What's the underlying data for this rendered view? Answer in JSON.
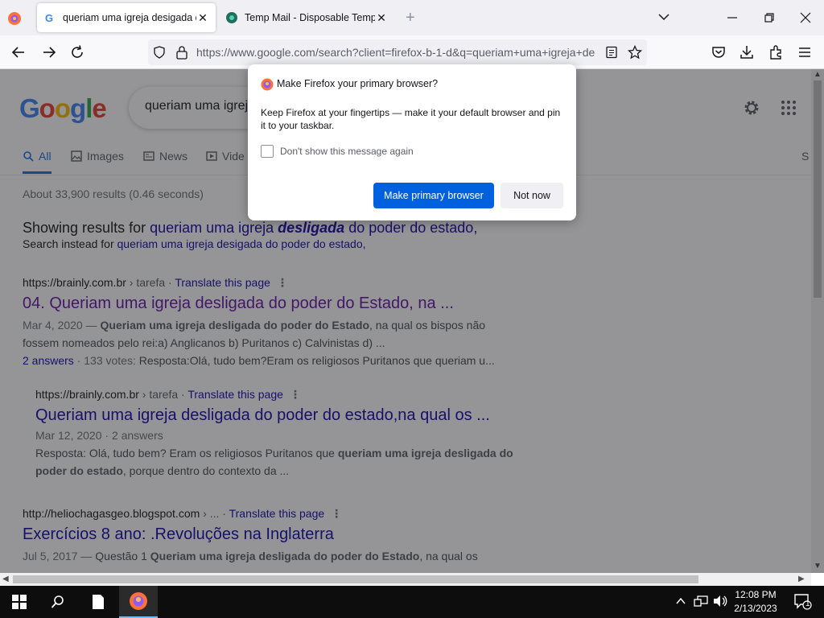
{
  "browser": {
    "tabs": [
      {
        "title": "queriam uma igreja desigada d",
        "active": true
      },
      {
        "title": "Temp Mail - Disposable Tempo",
        "active": false
      }
    ],
    "new_tab_symbol": "+",
    "url": "https://www.google.com/search?client=firefox-b-1-d&q=queriam+uma+igreja+de"
  },
  "google": {
    "logo": {
      "letters": [
        "G",
        "o",
        "o",
        "g",
        "l",
        "e"
      ],
      "colors": [
        "#4285f4",
        "#ea4335",
        "#fbbc05",
        "#4285f4",
        "#34a853",
        "#ea4335"
      ]
    },
    "query": "queriam uma igreja",
    "tabs": {
      "all": "All",
      "images": "Images",
      "news": "News",
      "videos": "Vide",
      "more_cut": "S"
    },
    "stats": "About 33,900 results (0.46 seconds)",
    "showing_prefix": "Showing results for ",
    "corrected_a": "queriam uma igreja ",
    "corrected_b": "desligada",
    "corrected_c": " do poder do estado,",
    "instead_prefix": "Search instead for ",
    "instead_link": "queriam uma igreja desigada do poder do estado,",
    "results": [
      {
        "cite_host": "https://brainly.com.br",
        "cite_path": " › tarefa",
        "translate": "Translate this page",
        "title": "04. Queriam uma igreja desligada do poder do Estado, na ...",
        "date": "Mar 4, 2020",
        "dash": " — ",
        "bold": "Queriam uma igreja desligada do poder do Estado",
        "snippet_rest": ", na qual os bispos não fossem nomeados pelo rei:a) Anglicanos b) Puritanos c) Calvinistas d) ...",
        "answers": "2 answers",
        "votes": " · 133 votes: ",
        "answer_text": "Resposta:Olá, tudo bem?Eram os religiosos Puritanos que queriam u..."
      },
      {
        "cite_host": "https://brainly.com.br",
        "cite_path": " › tarefa",
        "translate": "Translate this page",
        "title": "Queriam uma igreja desligada do poder do estado,na qual os ...",
        "meta": "Mar 12, 2020 · 2 answers",
        "snippet_a": "Resposta: Olá, tudo bem? Eram os religiosos Puritanos que ",
        "bold": "queriam uma igreja desligada do poder do estado",
        "snippet_b": ", porque dentro do contexto da ..."
      },
      {
        "cite_host": "http://heliochagasgeo.blogspot.com",
        "cite_path": " › ...",
        "translate": "Translate this page",
        "title": "Exercícios 8 ano: .Revoluções na Inglaterra",
        "date": "Jul 5, 2017",
        "dash": " — ",
        "snippet_a": "Questão 1 ",
        "bold": "Queriam uma igreja desligada do poder do Estado",
        "snippet_b": ", na qual os"
      }
    ]
  },
  "dialog": {
    "title": "Make Firefox your primary browser?",
    "body": "Keep Firefox at your fingertips — make it your default browser and pin it to your taskbar.",
    "checkbox_label": "Don't show this message again",
    "checkbox_checked": false,
    "primary_button": "Make primary browser",
    "secondary_button": "Not now"
  },
  "taskbar": {
    "time": "12:08 PM",
    "date": "2/13/2023",
    "notifications": "1"
  }
}
